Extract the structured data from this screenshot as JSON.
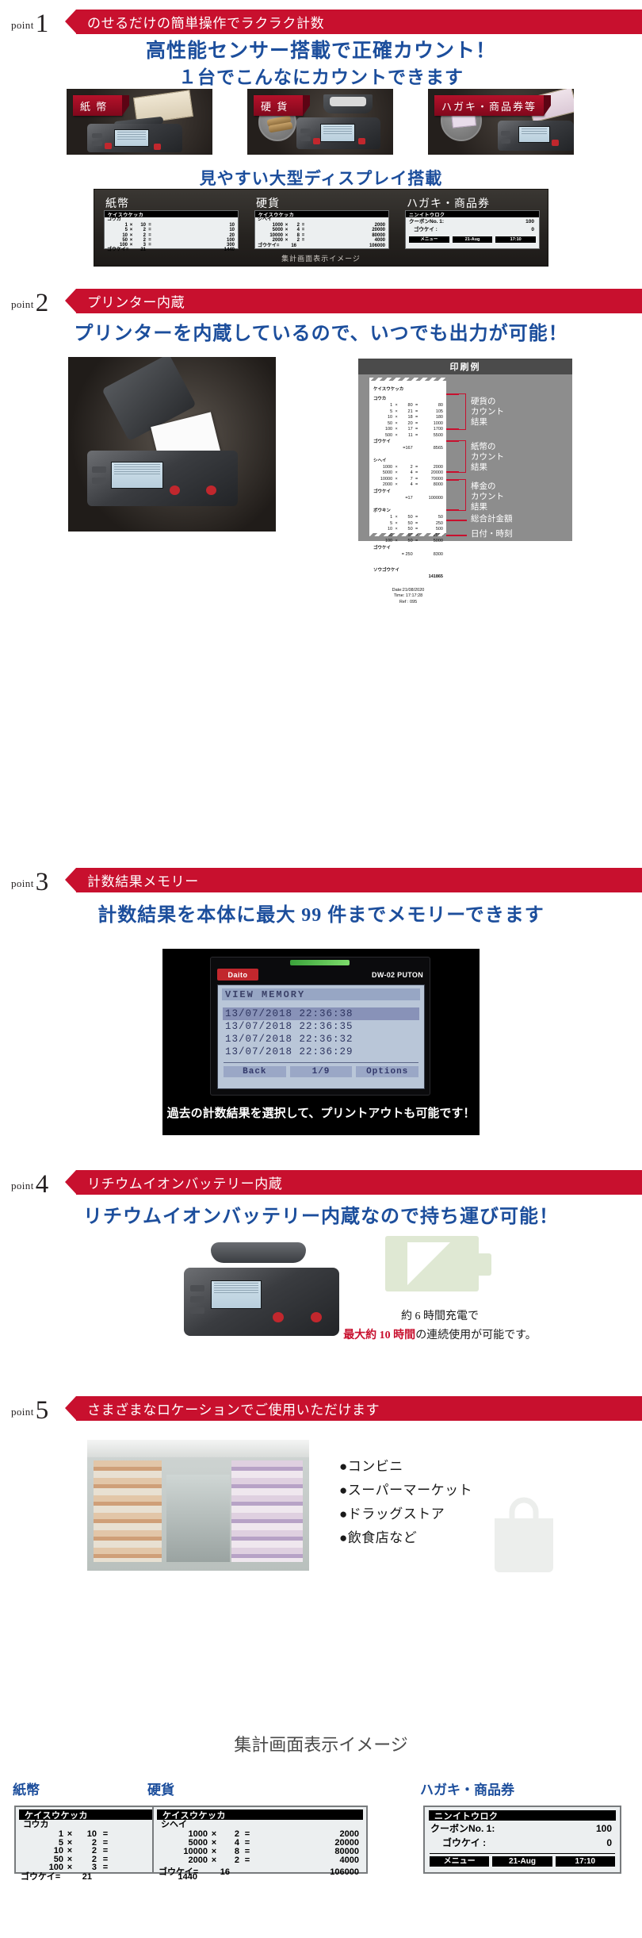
{
  "points": [
    {
      "num": "1",
      "word": "point",
      "bar_label": "のせるだけの簡単操作でラクラク計数",
      "headline1": "高性能センサー搭載で正確カウント！",
      "headline2": "１台でこんなにカウントできます",
      "photo_labels": [
        "紙 幣",
        "硬 貨",
        "ハガキ・商品券等"
      ],
      "display_headline": "見やすい大型ディスプレイ搭載",
      "display_caption": "集計画面表示イメージ"
    },
    {
      "num": "2",
      "word": "point",
      "bar_label": "プリンター内蔵",
      "headline1": "プリンターを内蔵しているので、いつでも出力が可能！",
      "print_title": "印刷例"
    },
    {
      "num": "3",
      "word": "point",
      "bar_label": "計数結果メモリー",
      "headline1": "計数結果を本体に最大 99 件までメモリーできます",
      "caption": "過去の計数結果を選択して、プリントアウトも可能です！"
    },
    {
      "num": "4",
      "word": "point",
      "bar_label": "リチウムイオンバッテリー内蔵",
      "headline1": "リチウムイオンバッテリー内蔵なので持ち運び可能！",
      "batt_line1": "約 6 時間充電で",
      "batt_line2_red": "最大約 10 時間",
      "batt_line2_rest": "の連続使用が可能です。"
    },
    {
      "num": "5",
      "word": "point",
      "bar_label": "さまざまなロケーションでご使用いただけます",
      "locations": [
        "●コンビニ",
        "●スーパーマーケット",
        "●ドラッグストア",
        "●飲食店など"
      ]
    }
  ],
  "display_panel": {
    "columns": [
      "紙幣",
      "硬貨",
      "ハガキ・商品券"
    ],
    "lcd_coin": {
      "title": "ケイスウケッカ",
      "sub": "コウカ",
      "rows": [
        {
          "denom": "1",
          "mul": "×",
          "qty": "10",
          "eq": "=",
          "value": "10"
        },
        {
          "denom": "5",
          "mul": "×",
          "qty": "2",
          "eq": "=",
          "value": "10"
        },
        {
          "denom": "10",
          "mul": "×",
          "qty": "2",
          "eq": "=",
          "value": "20"
        },
        {
          "denom": "50",
          "mul": "×",
          "qty": "2",
          "eq": "=",
          "value": "100"
        },
        {
          "denom": "100",
          "mul": "×",
          "qty": "3",
          "eq": "=",
          "value": "300"
        }
      ],
      "total_label": "ゴウケイ=",
      "total_qty": "21",
      "total_value": "1440"
    },
    "lcd_bill": {
      "title": "ケイスウケッカ",
      "sub": "シヘイ",
      "rows": [
        {
          "denom": "1000",
          "mul": "×",
          "qty": "2",
          "eq": "=",
          "value": "2000"
        },
        {
          "denom": "5000",
          "mul": "×",
          "qty": "4",
          "eq": "=",
          "value": "20000"
        },
        {
          "denom": "10000",
          "mul": "×",
          "qty": "8",
          "eq": "=",
          "value": "80000"
        },
        {
          "denom": "2000",
          "mul": "×",
          "qty": "2",
          "eq": "=",
          "value": "4000"
        }
      ],
      "total_label": "ゴウケイ=",
      "total_qty": "16",
      "total_value": "106000"
    },
    "lcd_coupon": {
      "title": "ニンイトウロク",
      "row1_label": "クーボンNo. 1:",
      "row1_value": "100",
      "row2_label": "ゴウケイ  :",
      "row2_value": "0",
      "foot": [
        "メニュー",
        "21-Aug",
        "17:10"
      ]
    }
  },
  "receipt": {
    "title": "ケイスウケッカ",
    "sections": [
      {
        "name": "コウカ",
        "rows": [
          {
            "denom": "1",
            "mul": "×",
            "qty": "80",
            "eq": "=",
            "value": "80"
          },
          {
            "denom": "5",
            "mul": "×",
            "qty": "21",
            "eq": "=",
            "value": "105"
          },
          {
            "denom": "10",
            "mul": "×",
            "qty": "18",
            "eq": "=",
            "value": "180"
          },
          {
            "denom": "50",
            "mul": "×",
            "qty": "20",
            "eq": "=",
            "value": "1000"
          },
          {
            "denom": "100",
            "mul": "×",
            "qty": "17",
            "eq": "=",
            "value": "1700"
          },
          {
            "denom": "500",
            "mul": "×",
            "qty": "11",
            "eq": "=",
            "value": "5500"
          }
        ],
        "total_label": "ゴウケイ",
        "total_qty": "=167",
        "total_value": "8565",
        "annotation": "硬貨の\nカウント\n結果"
      },
      {
        "name": "シヘイ",
        "rows": [
          {
            "denom": "1000",
            "mul": "×",
            "qty": "2",
            "eq": "=",
            "value": "2000"
          },
          {
            "denom": "5000",
            "mul": "×",
            "qty": "4",
            "eq": "=",
            "value": "20000"
          },
          {
            "denom": "10000",
            "mul": "×",
            "qty": "7",
            "eq": "=",
            "value": "70000"
          },
          {
            "denom": "2000",
            "mul": "×",
            "qty": "4",
            "eq": "=",
            "value": "8000"
          }
        ],
        "total_label": "ゴウケイ",
        "total_qty": "=17",
        "total_value": "100000",
        "annotation": "紙幣の\nカウント\n結果"
      },
      {
        "name": "ボウキン",
        "rows": [
          {
            "denom": "1",
            "mul": "×",
            "qty": "50",
            "eq": "=",
            "value": "50"
          },
          {
            "denom": "5",
            "mul": "×",
            "qty": "50",
            "eq": "=",
            "value": "250"
          },
          {
            "denom": "10",
            "mul": "×",
            "qty": "50",
            "eq": "=",
            "value": "500"
          },
          {
            "denom": "50",
            "mul": "×",
            "qty": "50",
            "eq": "=",
            "value": "2500"
          },
          {
            "denom": "100",
            "mul": "×",
            "qty": "50",
            "eq": "=",
            "value": "5000"
          }
        ],
        "total_label": "ゴウケイ",
        "total_qty": "= 250",
        "total_value": "8300",
        "annotation": "棒金の\nカウント\n結果"
      }
    ],
    "grand_label": "ソウゴウケイ",
    "grand_value": "141865",
    "grand_annotation": "総合計金額",
    "date_line": "Date:21/08/2020",
    "time_line": "Time:   17:17:28",
    "ref_line": "Ref :       095",
    "datetime_annotation": "日付・時刻"
  },
  "memory_screen": {
    "brand": "Daito",
    "model": "DW-02 PUTON",
    "title": "VIEW MEMORY",
    "entries": [
      "13/07/2018  22:36:38",
      "13/07/2018  22:36:35",
      "13/07/2018  22:36:32",
      "13/07/2018  22:36:29"
    ],
    "buttons": [
      "Back",
      "1/9",
      "Options"
    ]
  },
  "summary": {
    "title": "集計画面表示イメージ",
    "labels": [
      "紙幣",
      "硬貨",
      "ハガキ・商品券"
    ]
  },
  "colors": {
    "accent_red": "#c8102e",
    "headline_blue": "#1c4e9c"
  }
}
